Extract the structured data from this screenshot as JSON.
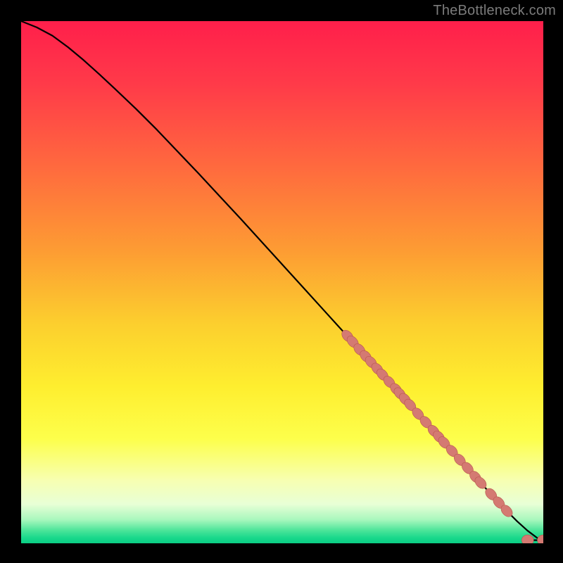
{
  "watermark": "TheBottleneck.com",
  "colors": {
    "background": "#000000",
    "watermark_text": "#7b7b7b",
    "curve": "#000000",
    "marker_fill": "#d47a72",
    "marker_stroke": "#b8564d",
    "gradient_stops": [
      {
        "offset": 0.0,
        "color": "#ff1f4b"
      },
      {
        "offset": 0.12,
        "color": "#ff3a49"
      },
      {
        "offset": 0.28,
        "color": "#ff6a3e"
      },
      {
        "offset": 0.44,
        "color": "#fd9c33"
      },
      {
        "offset": 0.58,
        "color": "#fccf2e"
      },
      {
        "offset": 0.7,
        "color": "#feee2f"
      },
      {
        "offset": 0.8,
        "color": "#fdff4b"
      },
      {
        "offset": 0.88,
        "color": "#f7ffb2"
      },
      {
        "offset": 0.925,
        "color": "#e8ffd6"
      },
      {
        "offset": 0.955,
        "color": "#a8f7bd"
      },
      {
        "offset": 0.975,
        "color": "#4de59a"
      },
      {
        "offset": 0.99,
        "color": "#17d88b"
      },
      {
        "offset": 1.0,
        "color": "#0bce85"
      }
    ]
  },
  "chart_data": {
    "type": "line",
    "title": "",
    "xlabel": "",
    "ylabel": "",
    "xlim": [
      0,
      100
    ],
    "ylim": [
      0,
      100
    ],
    "grid": false,
    "legend": false,
    "background_gradient": true,
    "curve": {
      "name": "bottleneck-curve",
      "x": [
        0,
        3,
        6,
        9,
        12,
        15,
        18,
        22,
        26,
        30,
        34,
        38,
        42,
        46,
        50,
        54,
        58,
        62,
        66,
        70,
        74,
        78,
        82,
        86,
        90,
        93,
        95,
        97,
        99,
        100
      ],
      "y": [
        100,
        98.8,
        97.2,
        95.0,
        92.5,
        89.8,
        87.0,
        83.2,
        79.2,
        75.0,
        70.8,
        66.5,
        62.2,
        57.8,
        53.4,
        49.0,
        44.6,
        40.2,
        35.8,
        31.4,
        27.0,
        22.6,
        18.2,
        13.8,
        9.4,
        6.2,
        4.2,
        2.4,
        0.9,
        0.5
      ]
    },
    "series": [
      {
        "name": "marker-cluster",
        "type": "scatter",
        "color": "#d47a72",
        "x": [
          62.5,
          63.5,
          64.8,
          66.0,
          67.0,
          68.2,
          69.2,
          70.5,
          71.8,
          72.5,
          73.5,
          74.5,
          76.0,
          77.5,
          79.0,
          80.0,
          81.0,
          82.5,
          84.0,
          85.5,
          87.0,
          88.0,
          90.0,
          91.5,
          93.0
        ],
        "y": [
          39.7,
          38.6,
          37.1,
          35.8,
          34.7,
          33.4,
          32.3,
          30.9,
          29.5,
          28.7,
          27.6,
          26.5,
          24.8,
          23.2,
          21.5,
          20.4,
          19.3,
          17.7,
          16.0,
          14.4,
          12.7,
          11.6,
          9.4,
          7.8,
          6.2
        ]
      },
      {
        "name": "marker-tail",
        "type": "scatter",
        "color": "#d47a72",
        "x": [
          97.0,
          100.0
        ],
        "y": [
          0.6,
          0.6
        ]
      }
    ]
  }
}
